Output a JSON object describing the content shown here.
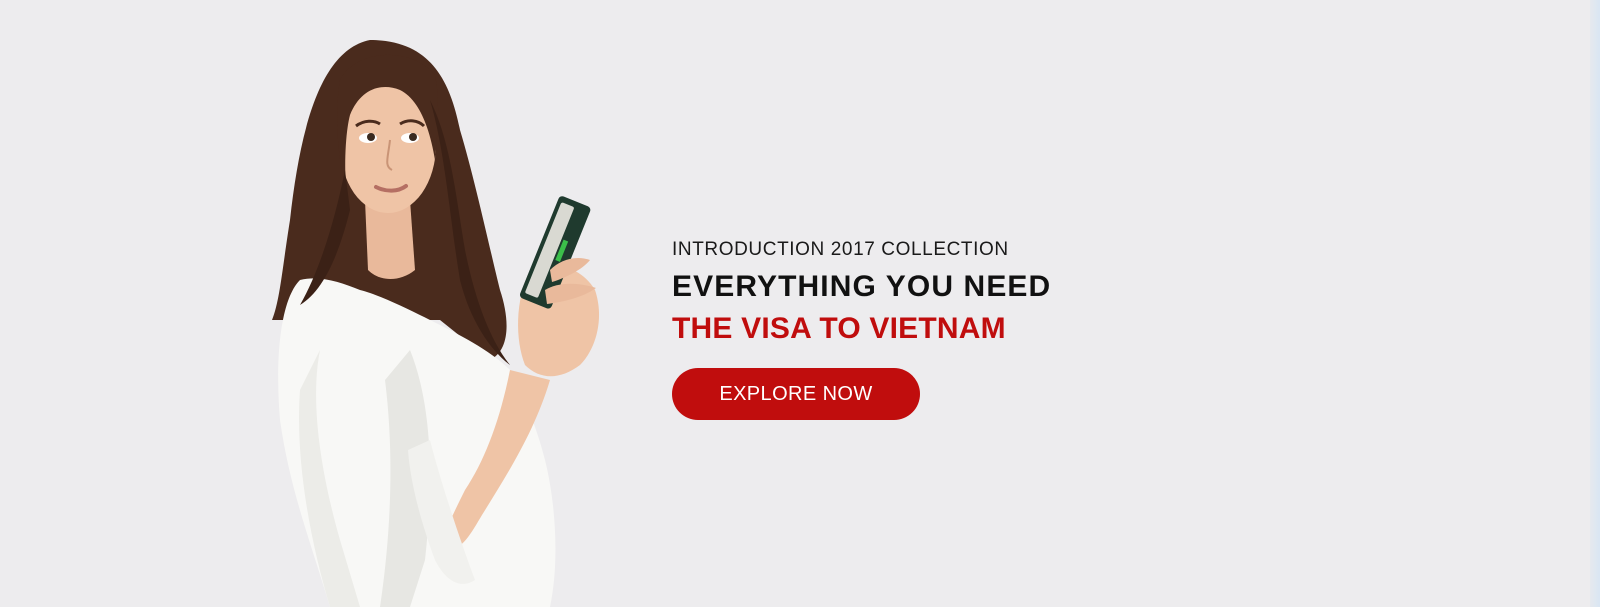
{
  "banner": {
    "intro_text": "INTRODUCTION 2017 COLLECTION",
    "headline": "EVERYTHING YOU NEED",
    "headline_highlight": "THE VISA TO VIETNAM",
    "cta_label": "EXPLORE NOW"
  },
  "colors": {
    "background": "#edecee",
    "accent_red": "#c00d0d",
    "cta_text": "#ffffff",
    "text_dark": "#111111"
  },
  "image": {
    "subject": "woman-holding-passport"
  }
}
